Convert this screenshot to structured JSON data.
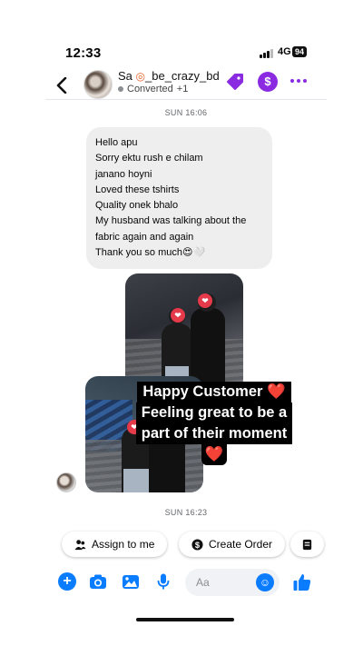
{
  "status_bar": {
    "time": "12:33",
    "network": "4G",
    "battery": "94"
  },
  "header": {
    "contact_name_prefix": "Sa",
    "contact_handle": "_be_crazy_bd",
    "status": "Converted",
    "extra": "+1",
    "icons": [
      "back-icon",
      "tag-icon",
      "dollar-icon",
      "more-icon"
    ]
  },
  "timestamps": {
    "first": "SUN 16:06",
    "second": "SUN 16:23"
  },
  "message": {
    "lines": [
      "Hello apu",
      "Sorry ektu rush e chilam",
      "janano hoyni",
      "Loved these tshirts",
      "Quality onek bhalo",
      "My husband was talking about the",
      "fabric again and again",
      "Thank you so much😍🤍"
    ]
  },
  "caption": {
    "line1": "Happy Customer ❤️",
    "line2": "Feeling great to be a",
    "line3": "part of their moment",
    "line4": "❤️"
  },
  "actions": {
    "assign": "Assign to me",
    "create_order": "Create Order"
  },
  "composer": {
    "placeholder": "Aa"
  },
  "colors": {
    "accent_purple": "#8a2be2",
    "messenger_blue": "#0a7cff",
    "bubble_gray": "#eeeeef"
  }
}
